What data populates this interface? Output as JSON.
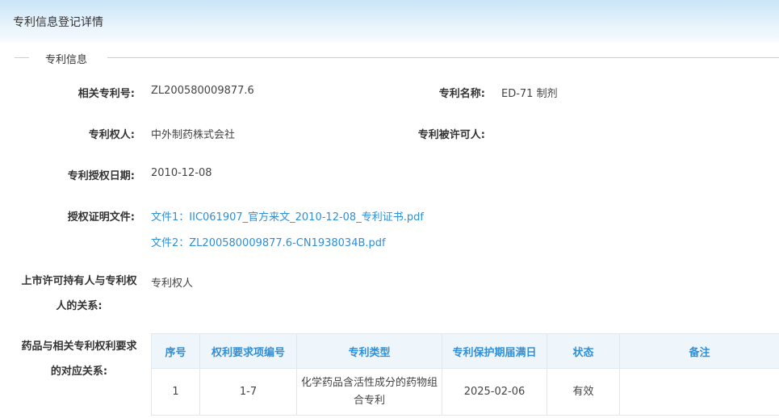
{
  "header": {
    "title": "专利信息登记详情"
  },
  "section": {
    "title": "专利信息"
  },
  "fields": {
    "patent_no_label": "相关专利号:",
    "patent_no": "ZL200580009877.6",
    "patent_name_label": "专利名称:",
    "patent_name": "ED-71 制剂",
    "holder_label": "专利权人:",
    "holder": "中外制药株式会社",
    "licensee_label": "专利被许可人:",
    "licensee": "",
    "grant_date_label": "专利授权日期:",
    "grant_date": "2010-12-08",
    "cert_label": "授权证明文件:",
    "files": [
      "文件1：IIC061907_官方来文_2010-12-08_专利证书.pdf",
      "文件2：ZL200580009877.6-CN1938034B.pdf"
    ],
    "relation_label_line1": "上市许可持有人与专利权",
    "relation_label_line2": "人的关系:",
    "relation": "专利权人",
    "claims_label_line1": "药品与相关专利权利要求",
    "claims_label_line2": "的对应关系:"
  },
  "claims_table": {
    "headers": [
      "序号",
      "权利要求项编号",
      "专利类型",
      "专利保护期届满日",
      "状态",
      "备注"
    ],
    "rows": [
      [
        "1",
        "1-7",
        "化学药品含活性成分的药物组合专利",
        "2025-02-06",
        "有效",
        ""
      ]
    ]
  }
}
